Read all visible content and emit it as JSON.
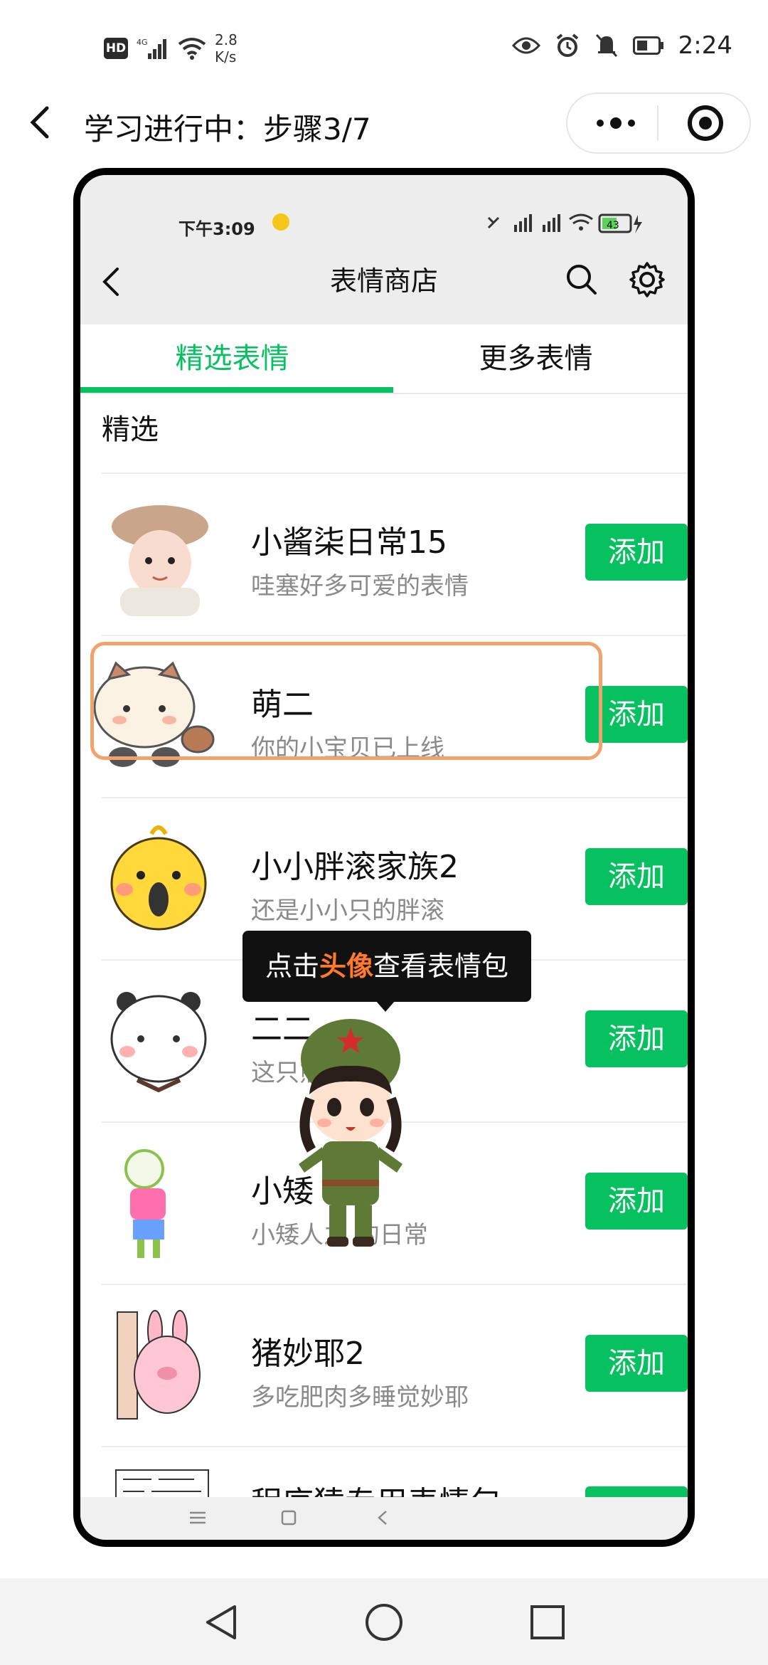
{
  "status_bar": {
    "hd": "HD",
    "signal": "4G",
    "net_speed": "2.8",
    "net_unit": "K/s",
    "time": "2:24"
  },
  "header": {
    "title": "学习进行中：步骤3/7"
  },
  "inner_app": {
    "status_time": "下午3:09",
    "battery": "43",
    "title": "表情商店",
    "tabs": [
      {
        "label": "精选表情",
        "active": true
      },
      {
        "label": "更多表情",
        "active": false
      }
    ],
    "section_title": "精选",
    "add_label": "添加",
    "items": [
      {
        "name": "小酱柒日常15",
        "desc": "哇塞好多可爱的表情"
      },
      {
        "name": "萌二",
        "desc": "你的小宝贝已上线"
      },
      {
        "name": "小小胖滚家族2",
        "desc": "还是小小只的胖滚"
      },
      {
        "name": "二二",
        "desc": "这只熊"
      },
      {
        "name": "小矮",
        "desc": "小矮人之    的日常"
      },
      {
        "name": "猪妙耶2",
        "desc": "多吃肥肉多睡觉妙耶"
      },
      {
        "name": "程序猿专用表情包",
        "desc": ""
      }
    ]
  },
  "tooltip": {
    "prefix": "点击",
    "highlight": "头像",
    "suffix": "查看表情包"
  },
  "colors": {
    "accent": "#07c160",
    "highlight_border": "#f2a26d",
    "tooltip_highlight": "#ff7a2b"
  }
}
